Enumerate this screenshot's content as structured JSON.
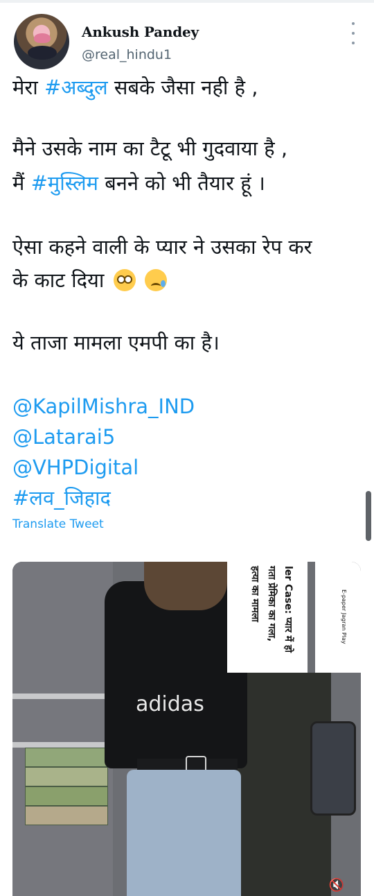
{
  "tweet": {
    "author_name": "Ankush Pandey",
    "author_handle": "@real_hindu1",
    "lines": [
      {
        "pre": "मेरा ",
        "tag": "#अब्दुल",
        "post": " सबके जैसा नही है ,"
      },
      {
        "pre": "मैने उसके नाम का टैटू भी गुदवाया है ,",
        "tag": "",
        "post": ""
      },
      {
        "pre": "मैं ",
        "tag": "#मुस्लिम",
        "post": " बनने को भी तैयार हूं ।"
      },
      {
        "pre": "ऐसा कहने वाली के प्यार ने उसका रेप कर",
        "tag": "",
        "post": ""
      },
      {
        "pre": "के काट दिया",
        "tag": "",
        "post": ""
      },
      {
        "pre": "ये ताजा मामला एमपी का है।",
        "tag": "",
        "post": ""
      }
    ],
    "emojis": [
      "flushed-face",
      "sad-but-relieved-face"
    ],
    "mentions": [
      "@KapilMishra_IND",
      "@Latarai5",
      "@VHPDigital"
    ],
    "hashtag": "#लव_जिहाद",
    "translate_label": "Translate Tweet"
  },
  "media": {
    "shirt_logo": "adidas",
    "overlay_text_1": "ler Case: प्यार में हो",
    "overlay_text_2": "गता प्रेमिका का गला,",
    "overlay_text_3": "हत्या का मामला",
    "overlay_text_4": "E-paper  Jagran Play",
    "mute_icon": "mute-icon"
  },
  "colors": {
    "link": "#1d9bf0",
    "secondary_text": "#536471"
  }
}
